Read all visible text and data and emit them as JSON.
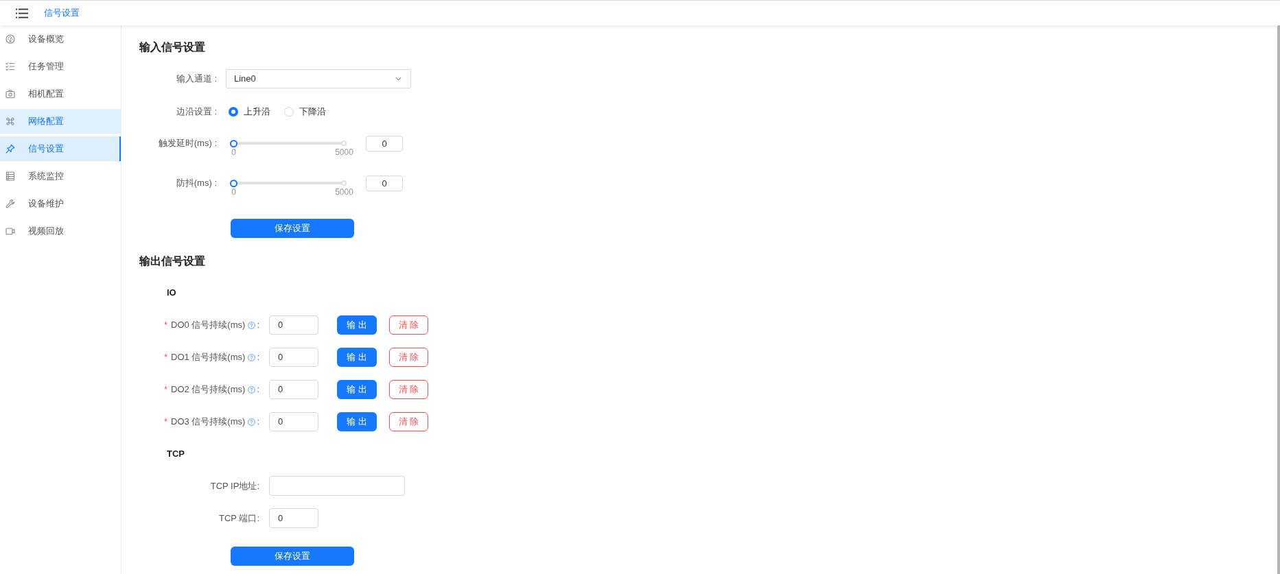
{
  "header": {
    "title": "信号设置"
  },
  "sidebar": {
    "items": [
      {
        "label": "设备概览",
        "selected": false,
        "hovered": false
      },
      {
        "label": "任务管理",
        "selected": false,
        "hovered": false
      },
      {
        "label": "相机配置",
        "selected": false,
        "hovered": false
      },
      {
        "label": "网络配置",
        "selected": false,
        "hovered": true
      },
      {
        "label": "信号设置",
        "selected": true,
        "hovered": false
      },
      {
        "label": "系统监控",
        "selected": false,
        "hovered": false
      },
      {
        "label": "设备维护",
        "selected": false,
        "hovered": false
      },
      {
        "label": "视频回放",
        "selected": false,
        "hovered": false
      }
    ]
  },
  "input_signal": {
    "title": "输入信号设置",
    "channel": {
      "label": "输入通道 :",
      "value": "Line0"
    },
    "edge": {
      "label": "边沿设置 :",
      "options": [
        {
          "label": "上升沿",
          "selected": true
        },
        {
          "label": "下降沿",
          "selected": false
        }
      ]
    },
    "sliders": [
      {
        "label": "触发延时(ms) :",
        "level": 0,
        "min_label": "0",
        "max_label": "5000",
        "value": "0"
      },
      {
        "label": "防抖(ms) :",
        "level": 0,
        "min_label": "0",
        "max_label": "5000",
        "value": "0"
      }
    ],
    "save_button": "保存设置"
  },
  "output_signal": {
    "title": "输出信号设置",
    "io": {
      "title": "IO",
      "rows": [
        {
          "required_mark": "*",
          "label": "DO0 信号持续(ms)",
          "colon": ":",
          "value": "0",
          "output_button": "输 出",
          "clear_button": "清 除"
        },
        {
          "required_mark": "*",
          "label": "DO1 信号持续(ms)",
          "colon": ":",
          "value": "0",
          "output_button": "输 出",
          "clear_button": "清 除"
        },
        {
          "required_mark": "*",
          "label": "DO2 信号持续(ms)",
          "colon": ":",
          "value": "0",
          "output_button": "输 出",
          "clear_button": "清 除"
        },
        {
          "required_mark": "*",
          "label": "DO3 信号持续(ms)",
          "colon": ":",
          "value": "0",
          "output_button": "输 出",
          "clear_button": "清 除"
        }
      ]
    },
    "tcp": {
      "title": "TCP",
      "fields": [
        {
          "label": "TCP IP地址:"
        },
        {
          "label": "TCP 端口:",
          "value": "0"
        }
      ]
    },
    "save_button": "保存设置"
  }
}
